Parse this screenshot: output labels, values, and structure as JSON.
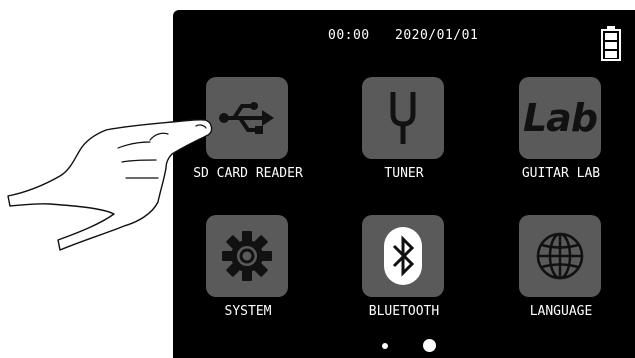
{
  "status": {
    "time": "00:00",
    "date": "2020/01/01",
    "battery_icon": "battery-full-icon"
  },
  "apps": [
    {
      "label": "SD CARD READER",
      "icon": "usb-icon"
    },
    {
      "label": "TUNER",
      "icon": "tuning-fork-icon"
    },
    {
      "label": "GUITAR LAB",
      "icon": "lab-icon",
      "icon_text": "Lab"
    },
    {
      "label": "SYSTEM",
      "icon": "gear-icon"
    },
    {
      "label": "BLUETOOTH",
      "icon": "bluetooth-icon"
    },
    {
      "label": "LANGUAGE",
      "icon": "globe-icon"
    }
  ],
  "pagination": {
    "pages": 2,
    "current": 2
  },
  "colors": {
    "screen": "#000000",
    "tile": "#5a5a5a",
    "text": "#ffffff"
  }
}
